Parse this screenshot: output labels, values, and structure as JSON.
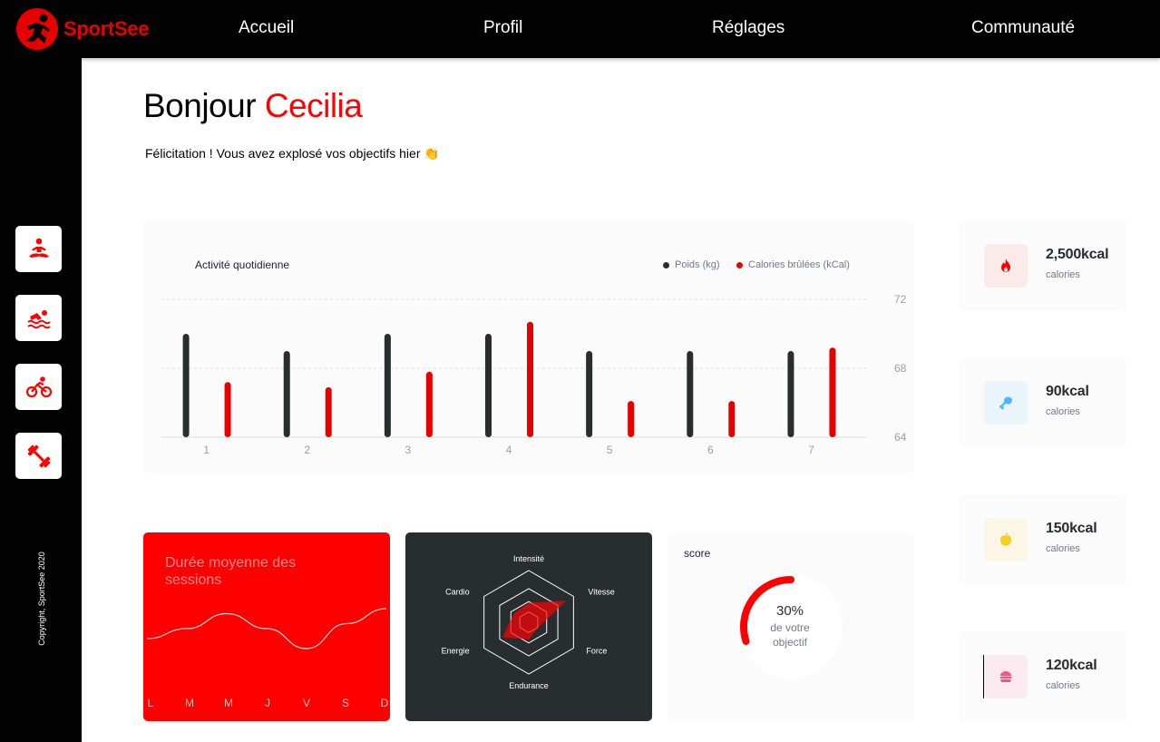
{
  "app": {
    "logo_text": "SportSee"
  },
  "nav": [
    {
      "label": "Accueil"
    },
    {
      "label": "Profil"
    },
    {
      "label": "Réglages"
    },
    {
      "label": "Communauté"
    }
  ],
  "sidebar": {
    "items": [
      {
        "icon": "yoga-icon"
      },
      {
        "icon": "swimming-icon"
      },
      {
        "icon": "cycling-icon"
      },
      {
        "icon": "dumbbell-icon"
      }
    ],
    "copyright": "Copyright, SportSee 2020"
  },
  "greeting": {
    "hello": "Bonjour",
    "name": "Cecilia",
    "message": "Félicitation ! Vous avez explosé vos objectifs hier 👏"
  },
  "colors": {
    "accent": "#ff0101",
    "dark": "#282d30",
    "weight_bar": "#282d30",
    "calorie_bar": "#e60000"
  },
  "activity": {
    "title": "Activité quotidienne",
    "legend_weight": "Poids (kg)",
    "legend_calories": "Calories brûlées (kCal)"
  },
  "sessions": {
    "title": "Durée moyenne des sessions",
    "days": [
      "L",
      "M",
      "M",
      "J",
      "V",
      "S",
      "D"
    ]
  },
  "score": {
    "title": "score",
    "percent": "30%",
    "line1": "de votre",
    "line2": "objectif",
    "value": 0.3
  },
  "key_data": [
    {
      "value": "2,500kcal",
      "label": "calories",
      "icon": "flame-icon",
      "bg": "#fbeaea",
      "color": "#ff0000"
    },
    {
      "value": "90kcal",
      "label": "calories",
      "icon": "chicken-icon",
      "bg": "#e9f4fb",
      "color": "#4ab8ff"
    },
    {
      "value": "150kcal",
      "label": "calories",
      "icon": "apple-icon",
      "bg": "#fbf6e5",
      "color": "#f9ce23"
    },
    {
      "value": "120kcal",
      "label": "calories",
      "icon": "burger-icon",
      "bg": "#fbeaef",
      "color": "#fd5181"
    }
  ],
  "chart_data": [
    {
      "type": "bar",
      "title": "Activité quotidienne",
      "categories": [
        "1",
        "2",
        "3",
        "4",
        "5",
        "6",
        "7"
      ],
      "y_ticks": [
        64,
        68,
        72
      ],
      "ylim": [
        64,
        72
      ],
      "grid": true,
      "legend": "top-right",
      "series": [
        {
          "name": "Poids (kg)",
          "values": [
            70,
            69,
            70,
            70,
            69,
            69,
            69
          ]
        },
        {
          "name": "Calories brûlées (kCal)",
          "values": [
            67.2,
            66.9,
            67.8,
            70.7,
            66.1,
            66.1,
            69.2
          ]
        }
      ]
    },
    {
      "type": "line",
      "title": "Durée moyenne des sessions",
      "categories": [
        "L",
        "M",
        "M",
        "J",
        "V",
        "S",
        "D"
      ],
      "series": [
        {
          "values": [
            30,
            40,
            55,
            40,
            20,
            45,
            60
          ]
        }
      ]
    },
    {
      "type": "radar",
      "axes": [
        "Intensité",
        "Vitesse",
        "Force",
        "Endurance",
        "Energie",
        "Cardio"
      ],
      "series": [
        {
          "values": [
            90,
            200,
            50,
            80,
            140,
            80
          ]
        }
      ],
      "max": 240
    }
  ]
}
